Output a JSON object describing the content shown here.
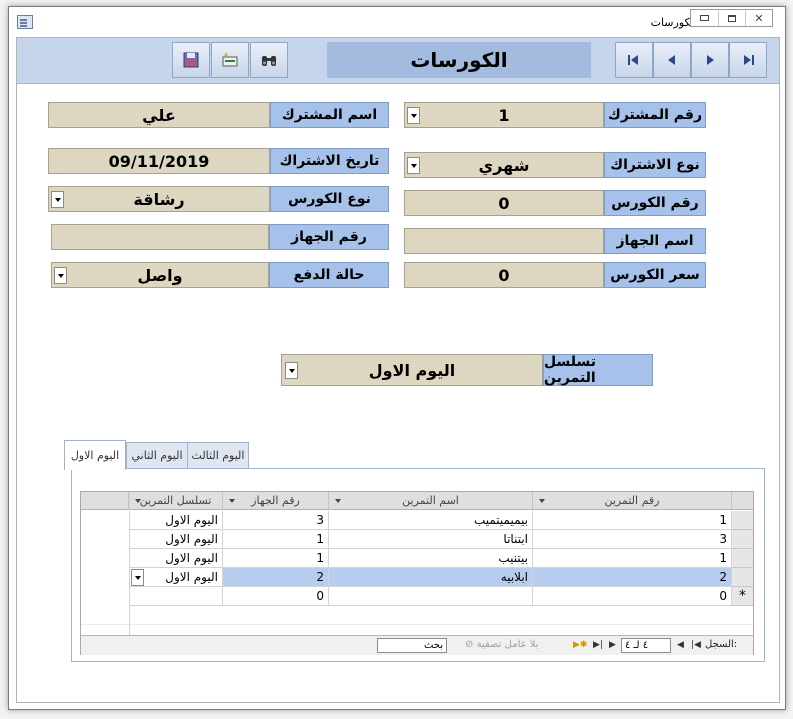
{
  "window": {
    "title": "الكورسات"
  },
  "header": {
    "title": "الكورسات"
  },
  "form": {
    "subscriber_number": {
      "label": "رقم المشترك",
      "value": "1"
    },
    "subscriber_name": {
      "label": "اسم المشترك",
      "value": "علي"
    },
    "subscription_type": {
      "label": "نوع الاشتراك",
      "value": "شهري"
    },
    "subscription_date": {
      "label": "تاريخ الاشتراك",
      "value": "09/11/2019"
    },
    "course_number": {
      "label": "رقم الكورس",
      "value": "0"
    },
    "course_type": {
      "label": "نوع الكورس",
      "value": "رشاقة"
    },
    "device_name": {
      "label": "اسم الجهاز",
      "value": ""
    },
    "device_number": {
      "label": "رقم الجهاز",
      "value": ""
    },
    "course_price": {
      "label": "سعر الكورس",
      "value": "0"
    },
    "payment_status": {
      "label": "حالة الدفع",
      "value": "واصل"
    },
    "exercise_sequence": {
      "label": "تسلسل التمرين",
      "value": "اليوم الاول"
    }
  },
  "tabs": [
    {
      "label": "اليوم الاول",
      "active": true
    },
    {
      "label": "اليوم الثاني",
      "active": false
    },
    {
      "label": "اليوم الثالث",
      "active": false
    }
  ],
  "grid": {
    "columns": [
      "رقم التمرين",
      "اسم التمرين",
      "رقم الجهاز",
      "تسلسل التمرين"
    ],
    "rows": [
      {
        "exercise_no": "1",
        "exercise_name": "بيميميتميب",
        "device_no": "3",
        "sequence": "اليوم الاول"
      },
      {
        "exercise_no": "3",
        "exercise_name": "ابتناتا",
        "device_no": "1",
        "sequence": "اليوم الاول"
      },
      {
        "exercise_no": "1",
        "exercise_name": "بيتنيب",
        "device_no": "1",
        "sequence": "اليوم الاول"
      },
      {
        "exercise_no": "2",
        "exercise_name": "ابلابيه",
        "device_no": "2",
        "sequence": "اليوم الاول"
      }
    ],
    "new_row": {
      "exercise_no": "0",
      "device_no": "0",
      "marker": "*"
    }
  },
  "record_nav": {
    "label": "السجل:",
    "position": "٤ لـ ٤",
    "filter_label": "بلا عامل تصفية",
    "search_placeholder": "بحث"
  },
  "colors": {
    "header_band": "#c5d5eb",
    "label_bg": "#a6c1ea",
    "field_bg": "#ddd6c1",
    "selected_row": "#b7cdef"
  },
  "icons": {
    "save": "save-icon",
    "new_record": "new-record-icon",
    "find": "binoculars-icon",
    "first": "first-record-icon",
    "previous": "previous-record-icon",
    "next": "next-record-icon",
    "last": "last-record-icon"
  }
}
